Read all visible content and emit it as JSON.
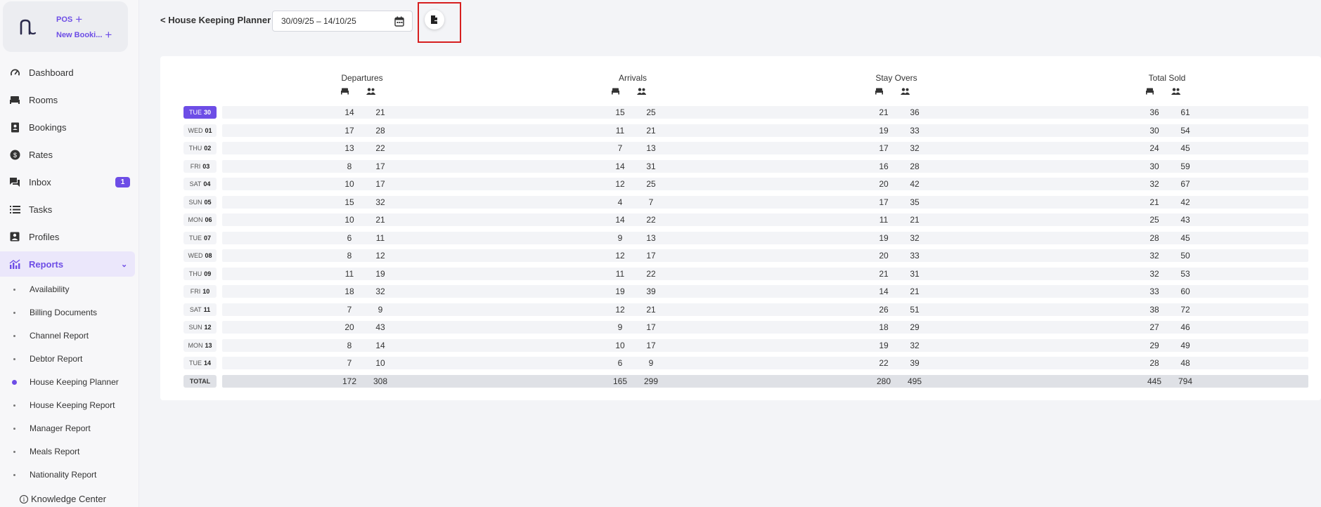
{
  "sidebar": {
    "quick_actions": [
      {
        "label": "POS"
      },
      {
        "label": "New Booki..."
      }
    ],
    "nav": [
      {
        "label": "Dashboard",
        "icon": "gauge-icon"
      },
      {
        "label": "Rooms",
        "icon": "bed-icon"
      },
      {
        "label": "Bookings",
        "icon": "contact-book-icon"
      },
      {
        "label": "Rates",
        "icon": "dollar-coin-icon"
      },
      {
        "label": "Inbox",
        "icon": "chat-icon",
        "badge": "1"
      },
      {
        "label": "Tasks",
        "icon": "list-icon"
      },
      {
        "label": "Profiles",
        "icon": "profile-icon"
      },
      {
        "label": "Reports",
        "icon": "chart-icon",
        "active": true
      }
    ],
    "reports_sub": [
      {
        "label": "Availability"
      },
      {
        "label": "Billing Documents"
      },
      {
        "label": "Channel Report"
      },
      {
        "label": "Debtor Report"
      },
      {
        "label": "House Keeping Planner",
        "active": true
      },
      {
        "label": "House Keeping Report"
      },
      {
        "label": "Manager Report"
      },
      {
        "label": "Meals Report"
      },
      {
        "label": "Nationality Report"
      }
    ],
    "knowledge_center": "Knowledge Center"
  },
  "header": {
    "back_label": "< House Keeping Planner",
    "date_range": "30/09/25 – 14/10/25",
    "export_icon": "export-file-icon"
  },
  "table": {
    "groups": [
      "Departures",
      "Arrivals",
      "Stay Overs",
      "Total Sold"
    ],
    "rows": [
      {
        "dow": "TUE",
        "day": "30",
        "active": true,
        "dep": [
          14,
          21
        ],
        "arr": [
          15,
          25
        ],
        "stay": [
          21,
          36
        ],
        "total": [
          36,
          61
        ]
      },
      {
        "dow": "WED",
        "day": "01",
        "dep": [
          17,
          28
        ],
        "arr": [
          11,
          21
        ],
        "stay": [
          19,
          33
        ],
        "total": [
          30,
          54
        ]
      },
      {
        "dow": "THU",
        "day": "02",
        "dep": [
          13,
          22
        ],
        "arr": [
          7,
          13
        ],
        "stay": [
          17,
          32
        ],
        "total": [
          24,
          45
        ]
      },
      {
        "dow": "FRI",
        "day": "03",
        "dep": [
          8,
          17
        ],
        "arr": [
          14,
          31
        ],
        "stay": [
          16,
          28
        ],
        "total": [
          30,
          59
        ]
      },
      {
        "dow": "SAT",
        "day": "04",
        "dep": [
          10,
          17
        ],
        "arr": [
          12,
          25
        ],
        "stay": [
          20,
          42
        ],
        "total": [
          32,
          67
        ]
      },
      {
        "dow": "SUN",
        "day": "05",
        "dep": [
          15,
          32
        ],
        "arr": [
          4,
          7
        ],
        "stay": [
          17,
          35
        ],
        "total": [
          21,
          42
        ]
      },
      {
        "dow": "MON",
        "day": "06",
        "dep": [
          10,
          21
        ],
        "arr": [
          14,
          22
        ],
        "stay": [
          11,
          21
        ],
        "total": [
          25,
          43
        ]
      },
      {
        "dow": "TUE",
        "day": "07",
        "dep": [
          6,
          11
        ],
        "arr": [
          9,
          13
        ],
        "stay": [
          19,
          32
        ],
        "total": [
          28,
          45
        ]
      },
      {
        "dow": "WED",
        "day": "08",
        "dep": [
          8,
          12
        ],
        "arr": [
          12,
          17
        ],
        "stay": [
          20,
          33
        ],
        "total": [
          32,
          50
        ]
      },
      {
        "dow": "THU",
        "day": "09",
        "dep": [
          11,
          19
        ],
        "arr": [
          11,
          22
        ],
        "stay": [
          21,
          31
        ],
        "total": [
          32,
          53
        ]
      },
      {
        "dow": "FRI",
        "day": "10",
        "dep": [
          18,
          32
        ],
        "arr": [
          19,
          39
        ],
        "stay": [
          14,
          21
        ],
        "total": [
          33,
          60
        ]
      },
      {
        "dow": "SAT",
        "day": "11",
        "dep": [
          7,
          9
        ],
        "arr": [
          12,
          21
        ],
        "stay": [
          26,
          51
        ],
        "total": [
          38,
          72
        ]
      },
      {
        "dow": "SUN",
        "day": "12",
        "dep": [
          20,
          43
        ],
        "arr": [
          9,
          17
        ],
        "stay": [
          18,
          29
        ],
        "total": [
          27,
          46
        ]
      },
      {
        "dow": "MON",
        "day": "13",
        "dep": [
          8,
          14
        ],
        "arr": [
          10,
          17
        ],
        "stay": [
          19,
          32
        ],
        "total": [
          29,
          49
        ]
      },
      {
        "dow": "TUE",
        "day": "14",
        "dep": [
          7,
          10
        ],
        "arr": [
          6,
          9
        ],
        "stay": [
          22,
          39
        ],
        "total": [
          28,
          48
        ]
      }
    ],
    "totals": {
      "label": "TOTAL",
      "dep": [
        172,
        308
      ],
      "arr": [
        165,
        299
      ],
      "stay": [
        280,
        495
      ],
      "total": [
        445,
        794
      ]
    }
  },
  "colors": {
    "accent": "#6d4de6",
    "highlight_border": "#d61f1f"
  }
}
